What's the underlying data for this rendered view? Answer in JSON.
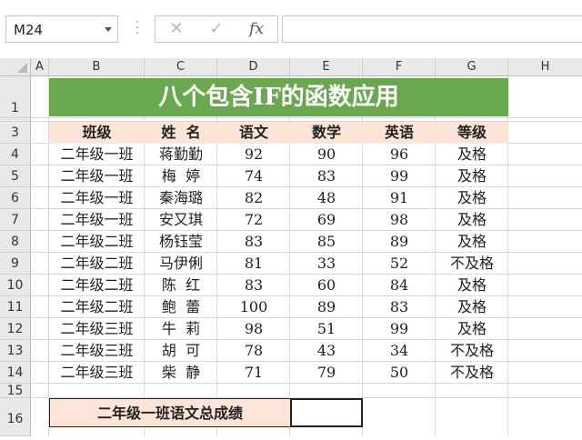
{
  "name_box": "M24",
  "formula_bar": {
    "cancel_icon": "✕",
    "enter_icon": "✓",
    "fx_label": "fx",
    "formula": ""
  },
  "columns": [
    "A",
    "B",
    "C",
    "D",
    "E",
    "F",
    "G",
    "H"
  ],
  "rows": [
    "1",
    "3",
    "4",
    "5",
    "6",
    "7",
    "8",
    "9",
    "10",
    "11",
    "12",
    "13",
    "14",
    "15",
    "16"
  ],
  "title": "八个包含IF的函数应用",
  "headers": [
    "班级",
    "姓  名",
    "语文",
    "数学",
    "英语",
    "等级"
  ],
  "table": [
    [
      "二年级一班",
      "蒋勤勤",
      "92",
      "90",
      "96",
      "及格"
    ],
    [
      "二年级一班",
      "梅  婷",
      "74",
      "83",
      "99",
      "及格"
    ],
    [
      "二年级一班",
      "秦海璐",
      "82",
      "48",
      "91",
      "及格"
    ],
    [
      "二年级一班",
      "安又琪",
      "72",
      "69",
      "98",
      "及格"
    ],
    [
      "二年级二班",
      "杨钰莹",
      "83",
      "85",
      "89",
      "及格"
    ],
    [
      "二年级二班",
      "马伊俐",
      "81",
      "33",
      "52",
      "不及格"
    ],
    [
      "二年级二班",
      "陈  红",
      "83",
      "60",
      "84",
      "及格"
    ],
    [
      "二年级二班",
      "鲍  蕾",
      "100",
      "89",
      "83",
      "及格"
    ],
    [
      "二年级三班",
      "牛  莉",
      "98",
      "51",
      "99",
      "及格"
    ],
    [
      "二年级三班",
      "胡  可",
      "78",
      "43",
      "34",
      "不及格"
    ],
    [
      "二年级三班",
      "柴  静",
      "71",
      "79",
      "50",
      "不及格"
    ]
  ],
  "summary": {
    "label": "二年级一班语文总成绩",
    "value": ""
  },
  "colors": {
    "title_bg": "#6aa84f",
    "header_bg": "#fce4d6",
    "grid_line": "#dadada"
  }
}
